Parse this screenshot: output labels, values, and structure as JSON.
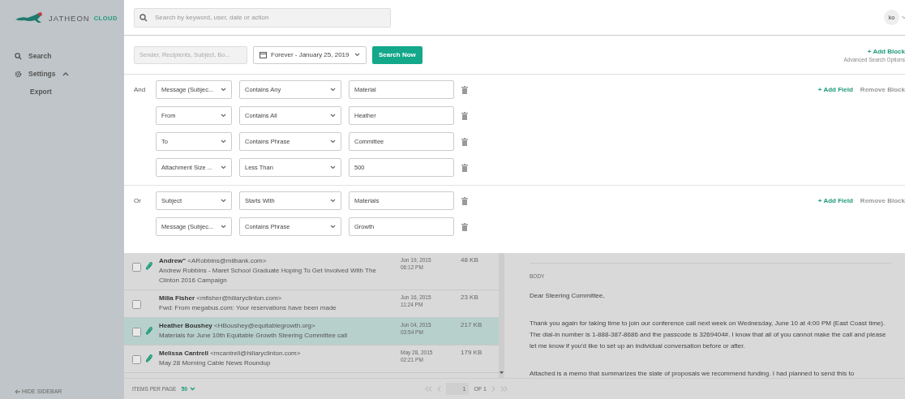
{
  "sidebar": {
    "logo": {
      "name": "JATHEON",
      "suffix": "CLOUD"
    },
    "items": [
      {
        "kind": "search",
        "label": "Search"
      },
      {
        "kind": "settings",
        "label": "Settings",
        "expanded": true,
        "children": [
          {
            "label": "Export"
          }
        ]
      }
    ],
    "hide_button": "HIDE SIDEBAR"
  },
  "header": {
    "search": {
      "placeholder": "Search by keyword, user, date or action"
    },
    "user": {
      "initials": "ko"
    }
  },
  "advanced_search": {
    "keyword": {
      "placeholder": "Sender, Recipients, Subject, Bo..."
    },
    "date_range": "Forever - January 25, 2019",
    "search_button": "Search Now",
    "add_block": "+ Add Block",
    "options_link": "Advanced Search Options",
    "blocks": [
      {
        "operator": "And",
        "add_field": "+ Add Field",
        "remove_block": "Remove Block",
        "conditions": [
          {
            "field": "Message (Subjec...",
            "match": "Contains Any",
            "value": "Material"
          },
          {
            "field": "From",
            "match": "Contains All",
            "value": "Heather"
          },
          {
            "field": "To",
            "match": "Contains Phrase",
            "value": "Committee"
          },
          {
            "field": "Attachment Size ...",
            "match": "Less Than",
            "value": "500"
          }
        ]
      },
      {
        "operator": "Or",
        "add_field": "+ Add Field",
        "remove_block": "Remove Block",
        "conditions": [
          {
            "field": "Subject",
            "match": "Starts With",
            "value": "Materials"
          },
          {
            "field": "Message (Subjec...",
            "match": "Contains Phrase",
            "value": "Growth"
          }
        ]
      }
    ]
  },
  "messages": [
    {
      "sender": "Andrew\"",
      "email": "<ARobbins@milbank.com>",
      "subject": "Andrew Robbins - Maret School Graduate Hoping To Get Involved With The Clinton 2016 Campaign",
      "date": "Jun 19, 2015",
      "time": "06:12 PM",
      "size": "48 KB",
      "attachment": true,
      "checked": false,
      "selected": false
    },
    {
      "sender": "Milia Fisher",
      "email": "<mfisher@hillaryclinton.com>",
      "subject": "Fwd: From megabus.com: Your reservations have been made",
      "date": "Jun 16, 2015",
      "time": "11:24 PM",
      "size": "23 KB",
      "attachment": false,
      "checked": false,
      "selected": false
    },
    {
      "sender": "Heather Boushey",
      "email": "<HBoushey@equitablegrowth.org>",
      "subject": "Materials for June 10th Equitable Growth Steering Committee call",
      "date": "Jun 04, 2015",
      "time": "03:54 PM",
      "size": "217 KB",
      "attachment": true,
      "checked": false,
      "selected": true
    },
    {
      "sender": "Melissa Cantrell",
      "email": "<mcantrell@hillaryclinton.com>",
      "subject": "May 28 Morning Cable News Roundup",
      "date": "May 28, 2015",
      "time": "02:21 PM",
      "size": "179 KB",
      "attachment": true,
      "checked": false,
      "selected": false
    }
  ],
  "pagination": {
    "items_per_page_label": "ITEMS PER PAGE",
    "items_per_page": "50",
    "page": "1",
    "of": "OF 1"
  },
  "preview": {
    "section": "BODY",
    "paragraphs": [
      "Dear Steering Committee,",
      "Thank you again for taking time to join our conference call next week on Wednesday, June 10 at 4:00 PM (East Coast time). The dial-in number is 1-888-387-8686 and the passcode is 3269404#. I know that all of you cannot make the call and please let me know if you'd like to set up an individual conversation before or after.",
      "Attached is a memo that summarizes the slate of proposals we recommend funding. I had planned to send this to"
    ]
  }
}
